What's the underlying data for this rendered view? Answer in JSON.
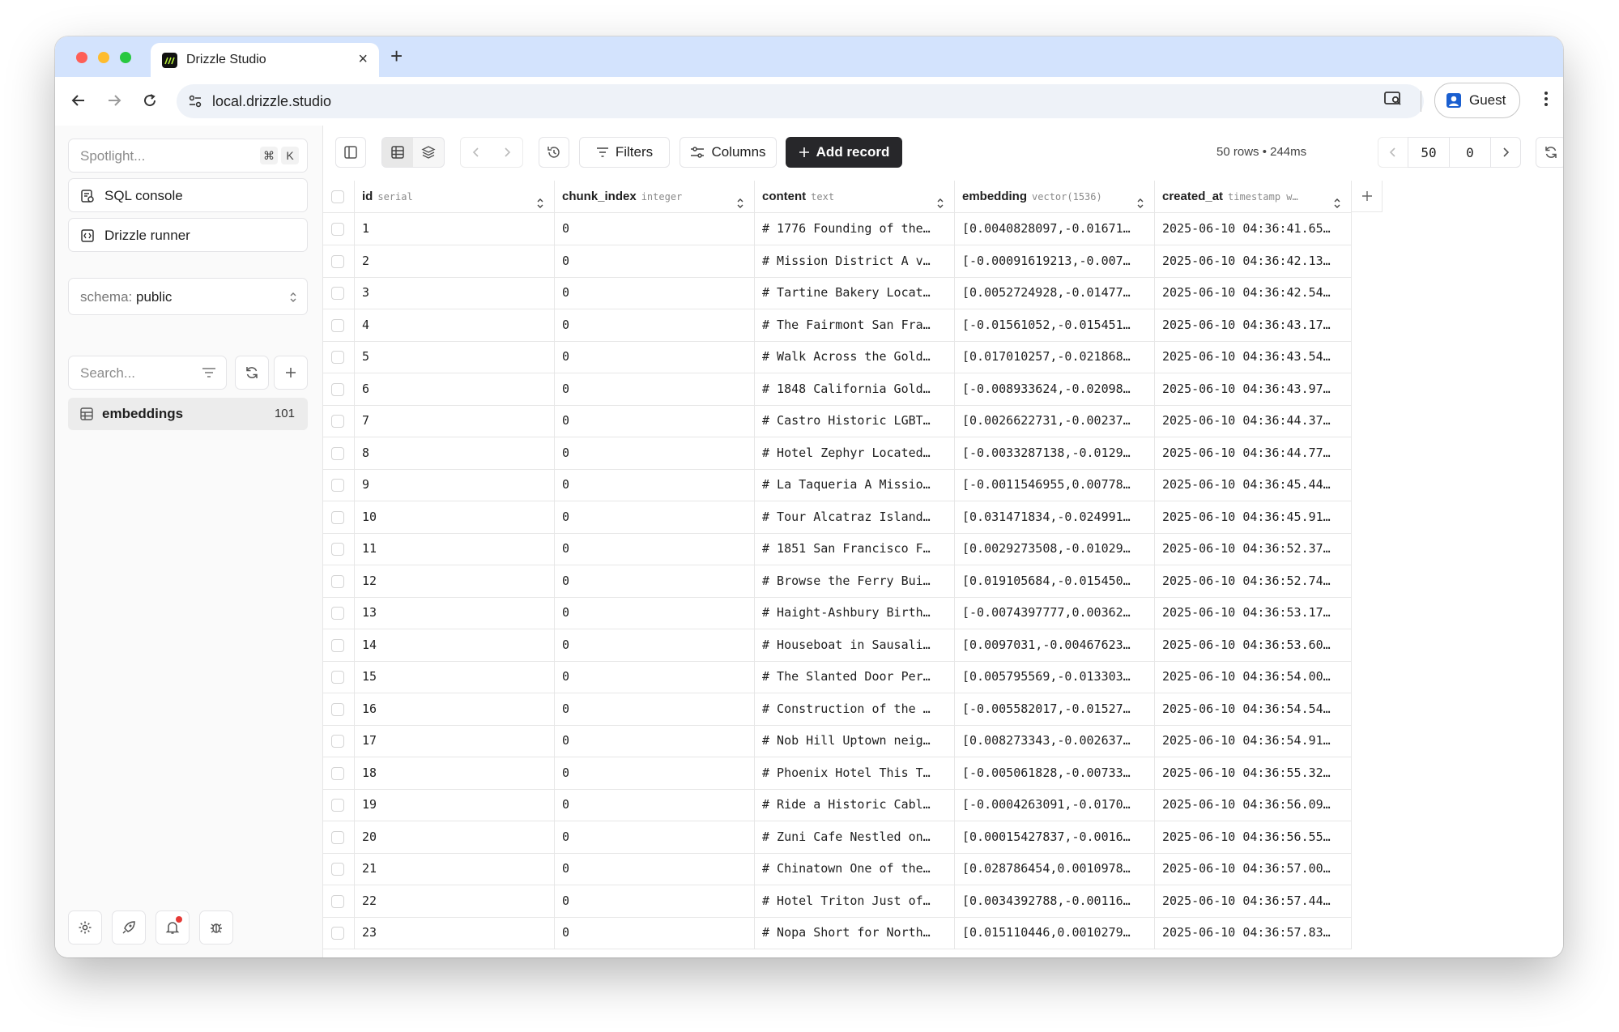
{
  "browser": {
    "tab_title": "Drizzle Studio",
    "url": "local.drizzle.studio",
    "profile_label": "Guest"
  },
  "sidebar": {
    "spotlight_placeholder": "Spotlight...",
    "spotlight_shortcut": [
      "⌘",
      "K"
    ],
    "sql_console_label": "SQL console",
    "drizzle_runner_label": "Drizzle runner",
    "schema_prefix": "schema:",
    "schema_value": "public",
    "search_placeholder": "Search...",
    "tables": [
      {
        "name": "embeddings",
        "count": "101"
      }
    ]
  },
  "toolbar": {
    "filters_label": "Filters",
    "columns_label": "Columns",
    "add_record_label": "Add record",
    "rows_info": "50 rows • 244ms",
    "page_size": "50",
    "offset": "0"
  },
  "table": {
    "columns": [
      {
        "name": "id",
        "type": "serial"
      },
      {
        "name": "chunk_index",
        "type": "integer"
      },
      {
        "name": "content",
        "type": "text"
      },
      {
        "name": "embedding",
        "type": "vector(1536)"
      },
      {
        "name": "created_at",
        "type": "timestamp w…"
      }
    ],
    "rows": [
      [
        "1",
        "0",
        "# 1776 Founding of the…",
        "[0.0040828097,-0.01671…",
        "2025-06-10 04:36:41.65…"
      ],
      [
        "2",
        "0",
        "# Mission District A v…",
        "[-0.00091619213,-0.007…",
        "2025-06-10 04:36:42.13…"
      ],
      [
        "3",
        "0",
        "# Tartine Bakery Locat…",
        "[0.0052724928,-0.01477…",
        "2025-06-10 04:36:42.54…"
      ],
      [
        "4",
        "0",
        "# The Fairmont San Fra…",
        "[-0.01561052,-0.015451…",
        "2025-06-10 04:36:43.17…"
      ],
      [
        "5",
        "0",
        "# Walk Across the Gold…",
        "[0.017010257,-0.021868…",
        "2025-06-10 04:36:43.54…"
      ],
      [
        "6",
        "0",
        "# 1848 California Gold…",
        "[-0.008933624,-0.02098…",
        "2025-06-10 04:36:43.97…"
      ],
      [
        "7",
        "0",
        "# Castro Historic LGBT…",
        "[0.0026622731,-0.00237…",
        "2025-06-10 04:36:44.37…"
      ],
      [
        "8",
        "0",
        "# Hotel Zephyr Located…",
        "[-0.0033287138,-0.0129…",
        "2025-06-10 04:36:44.77…"
      ],
      [
        "9",
        "0",
        "# La Taqueria A Missio…",
        "[-0.0011546955,0.00778…",
        "2025-06-10 04:36:45.44…"
      ],
      [
        "10",
        "0",
        "# Tour Alcatraz Island…",
        "[0.031471834,-0.024991…",
        "2025-06-10 04:36:45.91…"
      ],
      [
        "11",
        "0",
        "# 1851 San Francisco F…",
        "[0.0029273508,-0.01029…",
        "2025-06-10 04:36:52.37…"
      ],
      [
        "12",
        "0",
        "# Browse the Ferry Bui…",
        "[0.019105684,-0.015450…",
        "2025-06-10 04:36:52.74…"
      ],
      [
        "13",
        "0",
        "# Haight-Ashbury Birth…",
        "[-0.0074397777,0.00362…",
        "2025-06-10 04:36:53.17…"
      ],
      [
        "14",
        "0",
        "# Houseboat in Sausali…",
        "[0.0097031,-0.00467623…",
        "2025-06-10 04:36:53.60…"
      ],
      [
        "15",
        "0",
        "# The Slanted Door Per…",
        "[0.005795569,-0.013303…",
        "2025-06-10 04:36:54.00…"
      ],
      [
        "16",
        "0",
        "# Construction of the …",
        "[-0.005582017,-0.01527…",
        "2025-06-10 04:36:54.54…"
      ],
      [
        "17",
        "0",
        "# Nob Hill Uptown neig…",
        "[0.008273343,-0.002637…",
        "2025-06-10 04:36:54.91…"
      ],
      [
        "18",
        "0",
        "# Phoenix Hotel This T…",
        "[-0.005061828,-0.00733…",
        "2025-06-10 04:36:55.32…"
      ],
      [
        "19",
        "0",
        "# Ride a Historic Cabl…",
        "[-0.0004263091,-0.0170…",
        "2025-06-10 04:36:56.09…"
      ],
      [
        "20",
        "0",
        "# Zuni Cafe Nestled on…",
        "[0.00015427837,-0.0016…",
        "2025-06-10 04:36:56.55…"
      ],
      [
        "21",
        "0",
        "# Chinatown One of the…",
        "[0.028786454,0.0010978…",
        "2025-06-10 04:36:57.00…"
      ],
      [
        "22",
        "0",
        "# Hotel Triton Just of…",
        "[0.0034392788,-0.00116…",
        "2025-06-10 04:36:57.44…"
      ],
      [
        "23",
        "0",
        "# Nopa Short for North…",
        "[0.015110446,0.0010279…",
        "2025-06-10 04:36:57.83…"
      ]
    ]
  }
}
